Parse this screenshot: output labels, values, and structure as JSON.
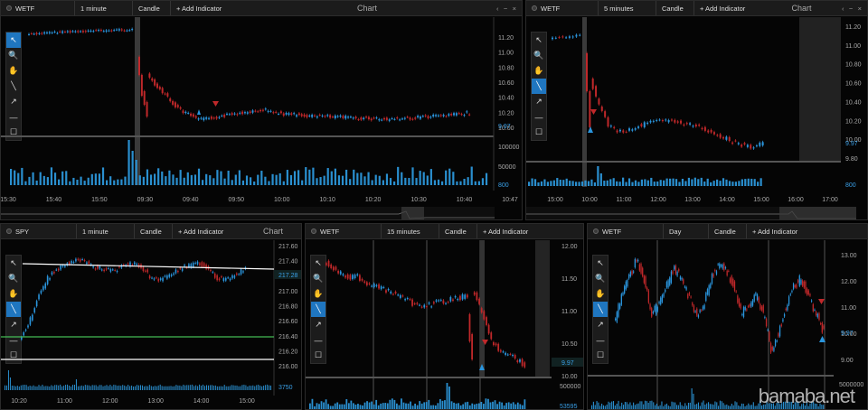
{
  "colors": {
    "up": "#2a95dd",
    "down": "#c0282a",
    "volume": "#2a8fcf",
    "trendline": "#ffffff",
    "support": "#44bb55",
    "accent": "#1f76c0"
  },
  "tools": [
    {
      "name": "pointer-icon",
      "glyph": "↖"
    },
    {
      "name": "zoom-icon",
      "glyph": "🔍"
    },
    {
      "name": "pan-hand-icon",
      "glyph": "✋"
    },
    {
      "name": "line-tool-icon",
      "glyph": "╲"
    },
    {
      "name": "arrow-tool-icon",
      "glyph": "↗"
    },
    {
      "name": "horizontal-line-icon",
      "glyph": "—"
    },
    {
      "name": "rectangle-tool-icon",
      "glyph": "☐"
    }
  ],
  "panels": [
    {
      "id": "p1",
      "symbol": "WETF",
      "timeframe": "1 minute",
      "chart_type": "Candle",
      "indicator": "+ Add Indicator",
      "caption": "Chart",
      "y_ticks": [
        "11.20",
        "11.00",
        "10.80",
        "10.60",
        "10.40",
        "10.20",
        "10.00"
      ],
      "price_label": "9.97",
      "vol_ticks": [
        "100000",
        "50000"
      ],
      "vol_label": "800",
      "x_ticks": [
        "15:30",
        "15:40",
        "15:50",
        "09:30",
        "09:40",
        "09:50",
        "10:00",
        "10:10",
        "10:20",
        "10:30",
        "10:40",
        "10:47"
      ]
    },
    {
      "id": "p2",
      "symbol": "WETF",
      "timeframe": "5 minutes",
      "chart_type": "Candle",
      "indicator": "+ Add Indicator",
      "caption": "Chart",
      "y_ticks": [
        "11.20",
        "11.00",
        "10.80",
        "10.60",
        "10.40",
        "10.20",
        "10.00",
        "9.80"
      ],
      "price_label": "9.97",
      "vol_label": "800",
      "x_ticks": [
        "15:00",
        "10:00",
        "11:00",
        "12:00",
        "13:00",
        "14:00",
        "15:00",
        "16:00",
        "17:00"
      ]
    },
    {
      "id": "p3",
      "symbol": "SPY",
      "timeframe": "1 minute",
      "chart_type": "Candle",
      "indicator": "+ Add Indicator",
      "caption": "Chart",
      "y_ticks": [
        "217.60",
        "217.40",
        "217.20",
        "217.00",
        "216.80",
        "216.60",
        "216.40",
        "216.20",
        "216.00"
      ],
      "price_label": "217.28",
      "vol_label": "3750",
      "x_ticks": [
        "10:20",
        "11:00",
        "12:00",
        "13:00",
        "14:00",
        "15:00"
      ]
    },
    {
      "id": "p4",
      "symbol": "WETF",
      "timeframe": "15 minutes",
      "chart_type": "Candle",
      "indicator": "+ Add Indicator",
      "caption": "",
      "y_ticks": [
        "12.00",
        "11.50",
        "11.00",
        "10.50",
        "10.00"
      ],
      "price_label": "9.97",
      "vol_ticks": [
        "500000"
      ],
      "vol_label": "53595",
      "x_ticks": []
    },
    {
      "id": "p5",
      "symbol": "WETF",
      "timeframe": "Day",
      "chart_type": "Candle",
      "indicator": "+ Add Indicator",
      "caption": "",
      "y_ticks": [
        "13.00",
        "12.00",
        "11.00",
        "10.00",
        "9.00"
      ],
      "price_label": "9.97",
      "vol_ticks": [
        "5000000"
      ],
      "vol_label": "",
      "x_ticks": []
    }
  ],
  "watermark": "bamaba.net"
}
